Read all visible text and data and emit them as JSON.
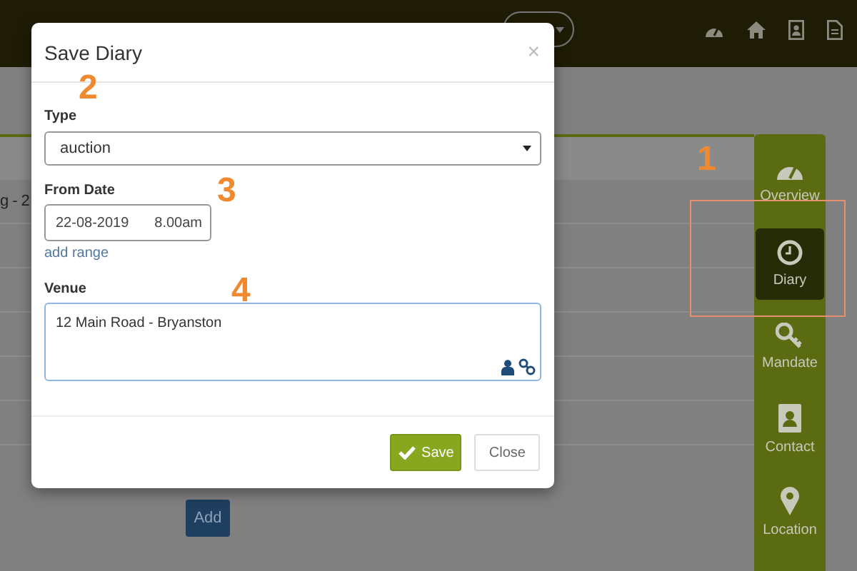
{
  "background": {
    "row_fragment": "g - 2",
    "add_button": "Add"
  },
  "sidebar": {
    "items": [
      {
        "label": "Overview",
        "selected": false
      },
      {
        "label": "Diary",
        "selected": true
      },
      {
        "label": "Mandate",
        "selected": false
      },
      {
        "label": "Contact",
        "selected": false
      },
      {
        "label": "Location",
        "selected": false
      }
    ]
  },
  "dialog": {
    "title": "Save Diary",
    "close": "×",
    "type": {
      "label": "Type",
      "value": "auction"
    },
    "from_date": {
      "label": "From Date",
      "date": "22-08-2019",
      "time": "8.00am",
      "link": "add range"
    },
    "venue": {
      "label": "Venue",
      "value": "12 Main Road - Bryanston"
    },
    "buttons": [
      {
        "label": "Save",
        "kind": "primary"
      },
      {
        "label": "Close",
        "kind": "default"
      }
    ]
  },
  "annotations": [
    "1",
    "2",
    "3",
    "4"
  ]
}
